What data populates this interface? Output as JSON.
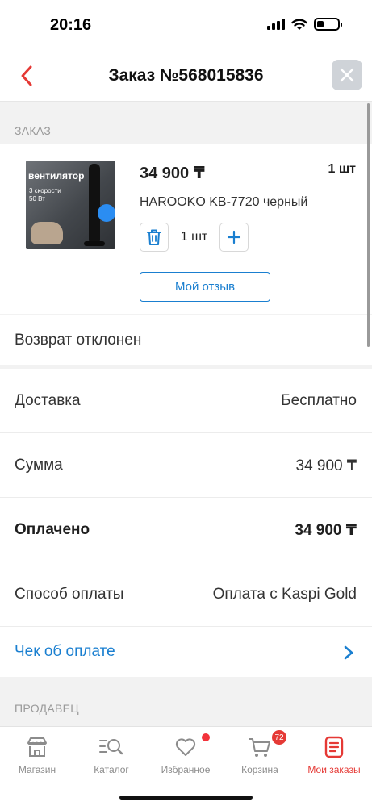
{
  "status_bar": {
    "time": "20:16"
  },
  "header": {
    "title": "Заказ №568015836"
  },
  "order_section": {
    "label": "ЗАКАЗ"
  },
  "product": {
    "price": "34 900 ₸",
    "qty_label": "1 шт",
    "name": "HAROOKO KB-7720 черный",
    "stepper_qty": "1 шт",
    "review_button": "Мой отзыв",
    "image_title": "вентилятор",
    "image_subtitle": "3 скорости\n50 Вт"
  },
  "return_status": "Возврат отклонен",
  "summary": {
    "rows": [
      {
        "label": "Доставка",
        "value": "Бесплатно"
      },
      {
        "label": "Сумма",
        "value": "34 900 ₸"
      },
      {
        "label": "Оплачено",
        "value": "34 900 ₸"
      },
      {
        "label": "Способ оплаты",
        "value": "Оплата с Kaspi Gold"
      }
    ],
    "receipt_link": "Чек об оплате"
  },
  "seller_section": {
    "label": "ПРОДАВЕЦ"
  },
  "tabbar": {
    "tabs": [
      {
        "label": "Магазин",
        "icon": "shop-icon"
      },
      {
        "label": "Каталог",
        "icon": "catalog-search-icon"
      },
      {
        "label": "Избранное",
        "icon": "heart-icon"
      },
      {
        "label": "Корзина",
        "icon": "cart-icon",
        "badge": "72"
      },
      {
        "label": "Мои заказы",
        "icon": "orders-icon",
        "active": true
      }
    ]
  },
  "colors": {
    "accent_blue": "#1a7fd0",
    "accent_red": "#e53935"
  }
}
